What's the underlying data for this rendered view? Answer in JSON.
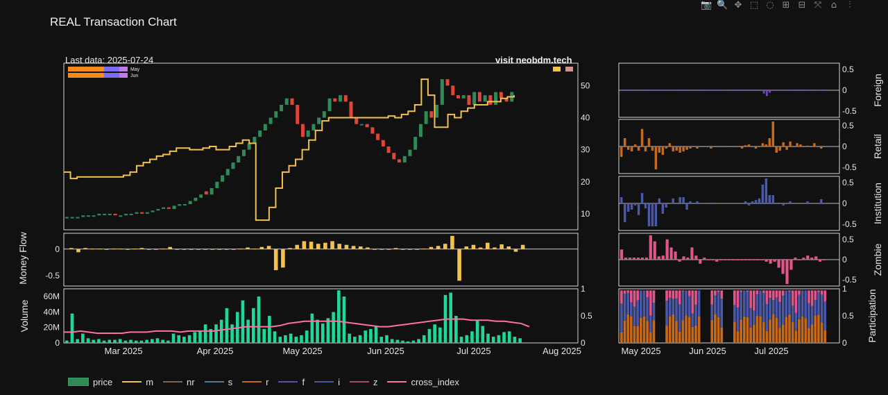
{
  "title": "REAL Transaction Chart",
  "toolbar": [
    "camera-icon",
    "zoom-icon",
    "pan-icon",
    "box-select-icon",
    "lasso-icon",
    "zoom-in-icon",
    "zoom-out-icon",
    "autoscale-icon",
    "reset-icon",
    "plotly-logo-icon"
  ],
  "annotations": {
    "last_data": "Last data: 2025-07-24",
    "site": "visit neobdm.tech",
    "month_legend": [
      "May",
      "Jun"
    ]
  },
  "axis_titles": {
    "money_flow": "Money Flow",
    "volume": "Volume",
    "foreign": "Foreign",
    "retail": "Retail",
    "institution": "Institution",
    "zombie": "Zombie",
    "participation": "Participation"
  },
  "legend": [
    {
      "label": "price",
      "color": "#2f8a57",
      "kind": "box"
    },
    {
      "label": "m",
      "color": "#f2c14e",
      "kind": "line"
    },
    {
      "label": "nr",
      "color": "#7a6a55",
      "kind": "line"
    },
    {
      "label": "s",
      "color": "#4e7e9a",
      "kind": "line"
    },
    {
      "label": "r",
      "color": "#c46a1a",
      "kind": "line"
    },
    {
      "label": "f",
      "color": "#6a4aa8",
      "kind": "line"
    },
    {
      "label": "i",
      "color": "#4a58a8",
      "kind": "line"
    },
    {
      "label": "z",
      "color": "#a84a72",
      "kind": "line"
    },
    {
      "label": "cross_index",
      "color": "#ff6fa8",
      "kind": "line"
    }
  ],
  "chart_data": [
    {
      "type": "candlestick",
      "name": "price",
      "x_ticks": [
        "Mar 2025",
        "Apr 2025",
        "May 2025",
        "Jun 2025",
        "Jul 2025",
        "Aug 2025"
      ],
      "y_ticks": [
        10,
        20,
        30,
        40,
        50
      ],
      "ylim": [
        5,
        57
      ],
      "colors": {
        "up": "#2f8a57",
        "down": "#e0453a"
      },
      "candles": [
        [
          0,
          9,
          9
        ],
        [
          1,
          9,
          9
        ],
        [
          2,
          9,
          9
        ],
        [
          3,
          9,
          9.5
        ],
        [
          4,
          9.5,
          9.5
        ],
        [
          5,
          9.5,
          9.5
        ],
        [
          6,
          9.5,
          10
        ],
        [
          7,
          10,
          10
        ],
        [
          8,
          10,
          10
        ],
        [
          9,
          10,
          9.5
        ],
        [
          10,
          9.5,
          9.5
        ],
        [
          11,
          9.5,
          10
        ],
        [
          12,
          10,
          10
        ],
        [
          13,
          10,
          10.5
        ],
        [
          14,
          10.5,
          10
        ],
        [
          15,
          10,
          10.5
        ],
        [
          16,
          10.5,
          11
        ],
        [
          17,
          11,
          11.5
        ],
        [
          18,
          11.5,
          12
        ],
        [
          19,
          12,
          11.5
        ],
        [
          20,
          11.5,
          12.5
        ],
        [
          21,
          12.5,
          13
        ],
        [
          22,
          13,
          13
        ],
        [
          23,
          13,
          14
        ],
        [
          24,
          14,
          15
        ],
        [
          25,
          15,
          16
        ],
        [
          26,
          17,
          16
        ],
        [
          27,
          16,
          18
        ],
        [
          28,
          18,
          20
        ],
        [
          29,
          20,
          22
        ],
        [
          30,
          22,
          24
        ],
        [
          31,
          24,
          26
        ],
        [
          32,
          26,
          28
        ],
        [
          33,
          28,
          30
        ],
        [
          34,
          30,
          32
        ],
        [
          35,
          32,
          34
        ],
        [
          36,
          34,
          36
        ],
        [
          37,
          36,
          38
        ],
        [
          38,
          38,
          40
        ],
        [
          39,
          40,
          42
        ],
        [
          40,
          42,
          44
        ],
        [
          41,
          44,
          46
        ],
        [
          42,
          46,
          44
        ],
        [
          43,
          44,
          38
        ],
        [
          44,
          38,
          34
        ],
        [
          45,
          34,
          36
        ],
        [
          46,
          36,
          38
        ],
        [
          47,
          38,
          40
        ],
        [
          48,
          40,
          42
        ],
        [
          49,
          42,
          46
        ],
        [
          50,
          46,
          45
        ],
        [
          51,
          45,
          47
        ],
        [
          52,
          47,
          45
        ],
        [
          53,
          45,
          40
        ],
        [
          54,
          40,
          38
        ],
        [
          55,
          38,
          38
        ],
        [
          56,
          38,
          37
        ],
        [
          57,
          37,
          35
        ],
        [
          58,
          35,
          33
        ],
        [
          59,
          33,
          31
        ],
        [
          60,
          31,
          29
        ],
        [
          61,
          29,
          27
        ],
        [
          62,
          27,
          26
        ],
        [
          63,
          26,
          28
        ],
        [
          64,
          28,
          30
        ],
        [
          65,
          30,
          34
        ],
        [
          66,
          34,
          38
        ],
        [
          67,
          38,
          42
        ],
        [
          68,
          42,
          40
        ],
        [
          69,
          40,
          44
        ],
        [
          70,
          44,
          52
        ],
        [
          71,
          52,
          50
        ],
        [
          72,
          50,
          47
        ],
        [
          73,
          47,
          46
        ],
        [
          74,
          46,
          47
        ],
        [
          75,
          47,
          44
        ],
        [
          76,
          44,
          48
        ],
        [
          77,
          48,
          45
        ],
        [
          78,
          45,
          47
        ],
        [
          79,
          47,
          44
        ],
        [
          80,
          44,
          48
        ],
        [
          81,
          48,
          46
        ],
        [
          82,
          46,
          45
        ],
        [
          83,
          45,
          48
        ]
      ],
      "series": [
        {
          "name": "m",
          "color": "#f2c14e",
          "values": [
            23,
            21,
            21.5,
            21.5,
            21.5,
            21.5,
            21.5,
            21.5,
            21.5,
            22,
            23,
            25,
            26,
            27,
            28,
            28.5,
            29.5,
            30.5,
            30.5,
            30,
            30,
            30.5,
            31,
            30,
            30,
            31,
            32,
            33,
            32,
            8,
            8,
            12,
            18,
            23,
            25,
            27,
            30,
            33,
            36,
            39,
            40,
            40,
            40,
            40,
            40,
            40,
            40,
            40,
            40,
            40.5,
            40,
            41,
            42,
            44,
            52,
            47,
            37,
            37,
            41,
            40,
            42,
            43,
            44,
            44,
            45,
            45,
            46,
            46.5,
            47
          ]
        },
        {
          "name": "cross_index",
          "color": "#ff6fa8",
          "values": [
            0.2,
            0.2,
            0.22,
            0.2,
            0.18,
            0.18,
            0.18,
            0.18,
            0.2,
            0.2,
            0.2,
            0.22,
            0.22,
            0.22,
            0.2,
            0.22,
            0.22,
            0.22,
            0.22,
            0.24,
            0.26,
            0.28,
            0.3,
            0.3,
            0.3,
            0.3,
            0.32,
            0.36,
            0.38,
            0.4,
            0.4,
            0.4,
            0.4,
            0.4,
            0.38,
            0.36,
            0.34,
            0.32,
            0.3,
            0.3,
            0.32,
            0.34,
            0.36,
            0.38,
            0.4,
            0.42,
            0.44,
            0.44,
            0.44,
            0.42,
            0.42,
            0.42,
            0.4,
            0.4,
            0.38,
            0.36,
            0.3
          ]
        }
      ]
    },
    {
      "type": "bar",
      "name": "money_flow",
      "y_ticks": [
        0,
        -0.5
      ],
      "ylim": [
        -0.7,
        0.3
      ],
      "color": "#f2c14e",
      "values": [
        0.02,
        -0.06,
        0.02,
        0.01,
        0.01,
        0.0,
        0.01,
        0.01,
        0.0,
        0.01,
        0.02,
        0.0,
        0.0,
        0.01,
        0.04,
        0.0,
        0.0,
        0.0,
        0.0,
        0.0,
        0.0,
        0.0,
        0.0,
        0.0,
        0.01,
        0.03,
        0.01,
        0.04,
        0.06,
        -0.4,
        -0.35,
        0.02,
        0.08,
        0.15,
        0.14,
        0.1,
        0.12,
        0.15,
        0.1,
        0.08,
        0.06,
        0.05,
        0.03,
        0.0,
        0.0,
        0.0,
        0.02,
        0.0,
        0.0,
        0.0,
        0.01,
        0.04,
        0.06,
        0.1,
        0.25,
        -0.6,
        0.05,
        0.08,
        0.03,
        0.12,
        0.03,
        0.09,
        0.05,
        -0.05,
        0.08
      ]
    },
    {
      "type": "bar",
      "name": "volume",
      "y_ticks": [
        "0",
        "20M",
        "40M",
        "60M"
      ],
      "y2_ticks": [
        0,
        0.5,
        1
      ],
      "ylim": [
        0,
        70
      ],
      "color": "#1fd69b",
      "values": [
        3,
        38,
        5,
        12,
        6,
        4,
        5,
        3,
        4,
        4,
        5,
        3,
        4,
        3,
        3,
        4,
        5,
        6,
        4,
        3,
        12,
        10,
        8,
        10,
        14,
        15,
        24,
        18,
        24,
        30,
        45,
        24,
        40,
        55,
        30,
        45,
        60,
        18,
        35,
        15,
        8,
        10,
        12,
        8,
        10,
        16,
        38,
        30,
        25,
        32,
        40,
        68,
        60,
        12,
        8,
        10,
        16,
        18,
        22,
        8,
        10,
        5,
        4,
        3,
        2,
        3,
        5,
        10,
        18,
        24,
        20,
        62,
        65,
        35,
        8,
        10,
        15,
        30,
        22,
        12,
        8,
        10,
        14,
        15,
        8,
        6
      ]
    },
    {
      "type": "bar",
      "name": "foreign",
      "y_ticks": [
        0.5,
        0,
        -0.5
      ],
      "ylim": [
        -0.65,
        0.65
      ],
      "color": "#6a4aa8",
      "values": [
        0,
        0,
        0,
        0,
        0,
        0,
        0,
        0,
        0,
        0,
        0,
        -0.01,
        0,
        0,
        0,
        0,
        0,
        0,
        0,
        0,
        0,
        0,
        0,
        0,
        0,
        0,
        0,
        0,
        0,
        0,
        0,
        0,
        0,
        0,
        0,
        0,
        0,
        0,
        0,
        0,
        0,
        0,
        0,
        0,
        0,
        0,
        0,
        0,
        0,
        -0.08,
        -0.14,
        -0.06,
        0,
        0,
        0,
        0,
        0,
        0,
        0,
        0,
        0,
        0,
        0,
        0,
        0,
        0,
        0,
        0,
        0,
        0,
        0
      ]
    },
    {
      "type": "bar",
      "name": "retail",
      "y_ticks": [
        0.5,
        0,
        -0.5
      ],
      "ylim": [
        -0.65,
        0.65
      ],
      "color": "#c46a1a",
      "values": [
        -0.25,
        0.2,
        -0.08,
        -0.12,
        0.05,
        -0.1,
        0.42,
        -0.12,
        0.2,
        -0.1,
        -0.55,
        -0.15,
        -0.2,
        -0.05,
        0.08,
        -0.12,
        -0.1,
        -0.15,
        -0.12,
        -0.08,
        -0.05,
        0.0,
        -0.05,
        0.0,
        0.0,
        0.0,
        -0.05,
        0.0,
        0.0,
        0.0,
        0.0,
        0.0,
        0.0,
        0.0,
        0.0,
        -0.05,
        0.03,
        0.05,
        0.0,
        -0.05,
        0.0,
        0.08,
        0.05,
        0.2,
        0.6,
        -0.15,
        -0.1,
        0.1,
        -0.08,
        0.12,
        0.0,
        0.08,
        0.05,
        0.0,
        0.02,
        0.0,
        0.08,
        0.0,
        -0.05,
        0.0
      ]
    },
    {
      "type": "bar",
      "name": "institution",
      "y_ticks": [
        0.5,
        0,
        -0.5
      ],
      "ylim": [
        -0.65,
        0.65
      ],
      "color": "#4a58a8",
      "values": [
        0.15,
        -0.45,
        -0.2,
        -0.15,
        -0.05,
        -0.28,
        0.25,
        -0.12,
        -0.55,
        -0.55,
        -0.55,
        0.12,
        -0.25,
        -0.1,
        0.0,
        0.12,
        0.0,
        0.15,
        0.15,
        -0.15,
        0.05,
        0.0,
        0.05,
        0.0,
        0.0,
        0.0,
        0.02,
        0.0,
        0.0,
        0.0,
        0.0,
        0.0,
        0.0,
        0.0,
        0.0,
        0.0,
        0.05,
        -0.05,
        0.05,
        0.08,
        0.12,
        0.45,
        0.6,
        0.2,
        0.2,
        0.0,
        0.0,
        -0.05,
        0.0,
        0.05,
        0.0,
        0.0,
        0.0,
        0.0,
        0.05,
        0.0,
        0.0,
        0.0,
        0.1,
        0.0
      ]
    },
    {
      "type": "bar",
      "name": "zombie",
      "y_ticks": [
        0.5,
        0,
        -0.5
      ],
      "ylim": [
        -0.65,
        0.65
      ],
      "color": "#e0568a",
      "values": [
        0.25,
        0.05,
        0.05,
        0.05,
        0.05,
        0.05,
        0.05,
        0.6,
        0.45,
        0.08,
        0.1,
        0.5,
        0.3,
        0.2,
        -0.05,
        0.08,
        0.05,
        0.3,
        0.1,
        -0.1,
        0.05,
        0.0,
        0.0,
        -0.05,
        0.0,
        0.0,
        0.0,
        0.0,
        0.0,
        0.0,
        0.0,
        0.0,
        0.0,
        0.0,
        0.0,
        -0.05,
        -0.1,
        -0.05,
        -0.2,
        -0.35,
        -0.6,
        -0.25,
        0.05,
        0.0,
        0.05,
        0.1,
        0.05,
        0.08,
        -0.05,
        0.0
      ]
    },
    {
      "type": "stacked_bar",
      "name": "participation",
      "y_ticks": [
        0,
        0.5,
        1
      ],
      "ylim": [
        0,
        1
      ],
      "x_ticks": [
        "May 2025",
        "Jun 2025",
        "Jul 2025"
      ],
      "colors": {
        "r": "#c46a1a",
        "i": "#4a58a8",
        "z": "#e0568a"
      }
    }
  ]
}
